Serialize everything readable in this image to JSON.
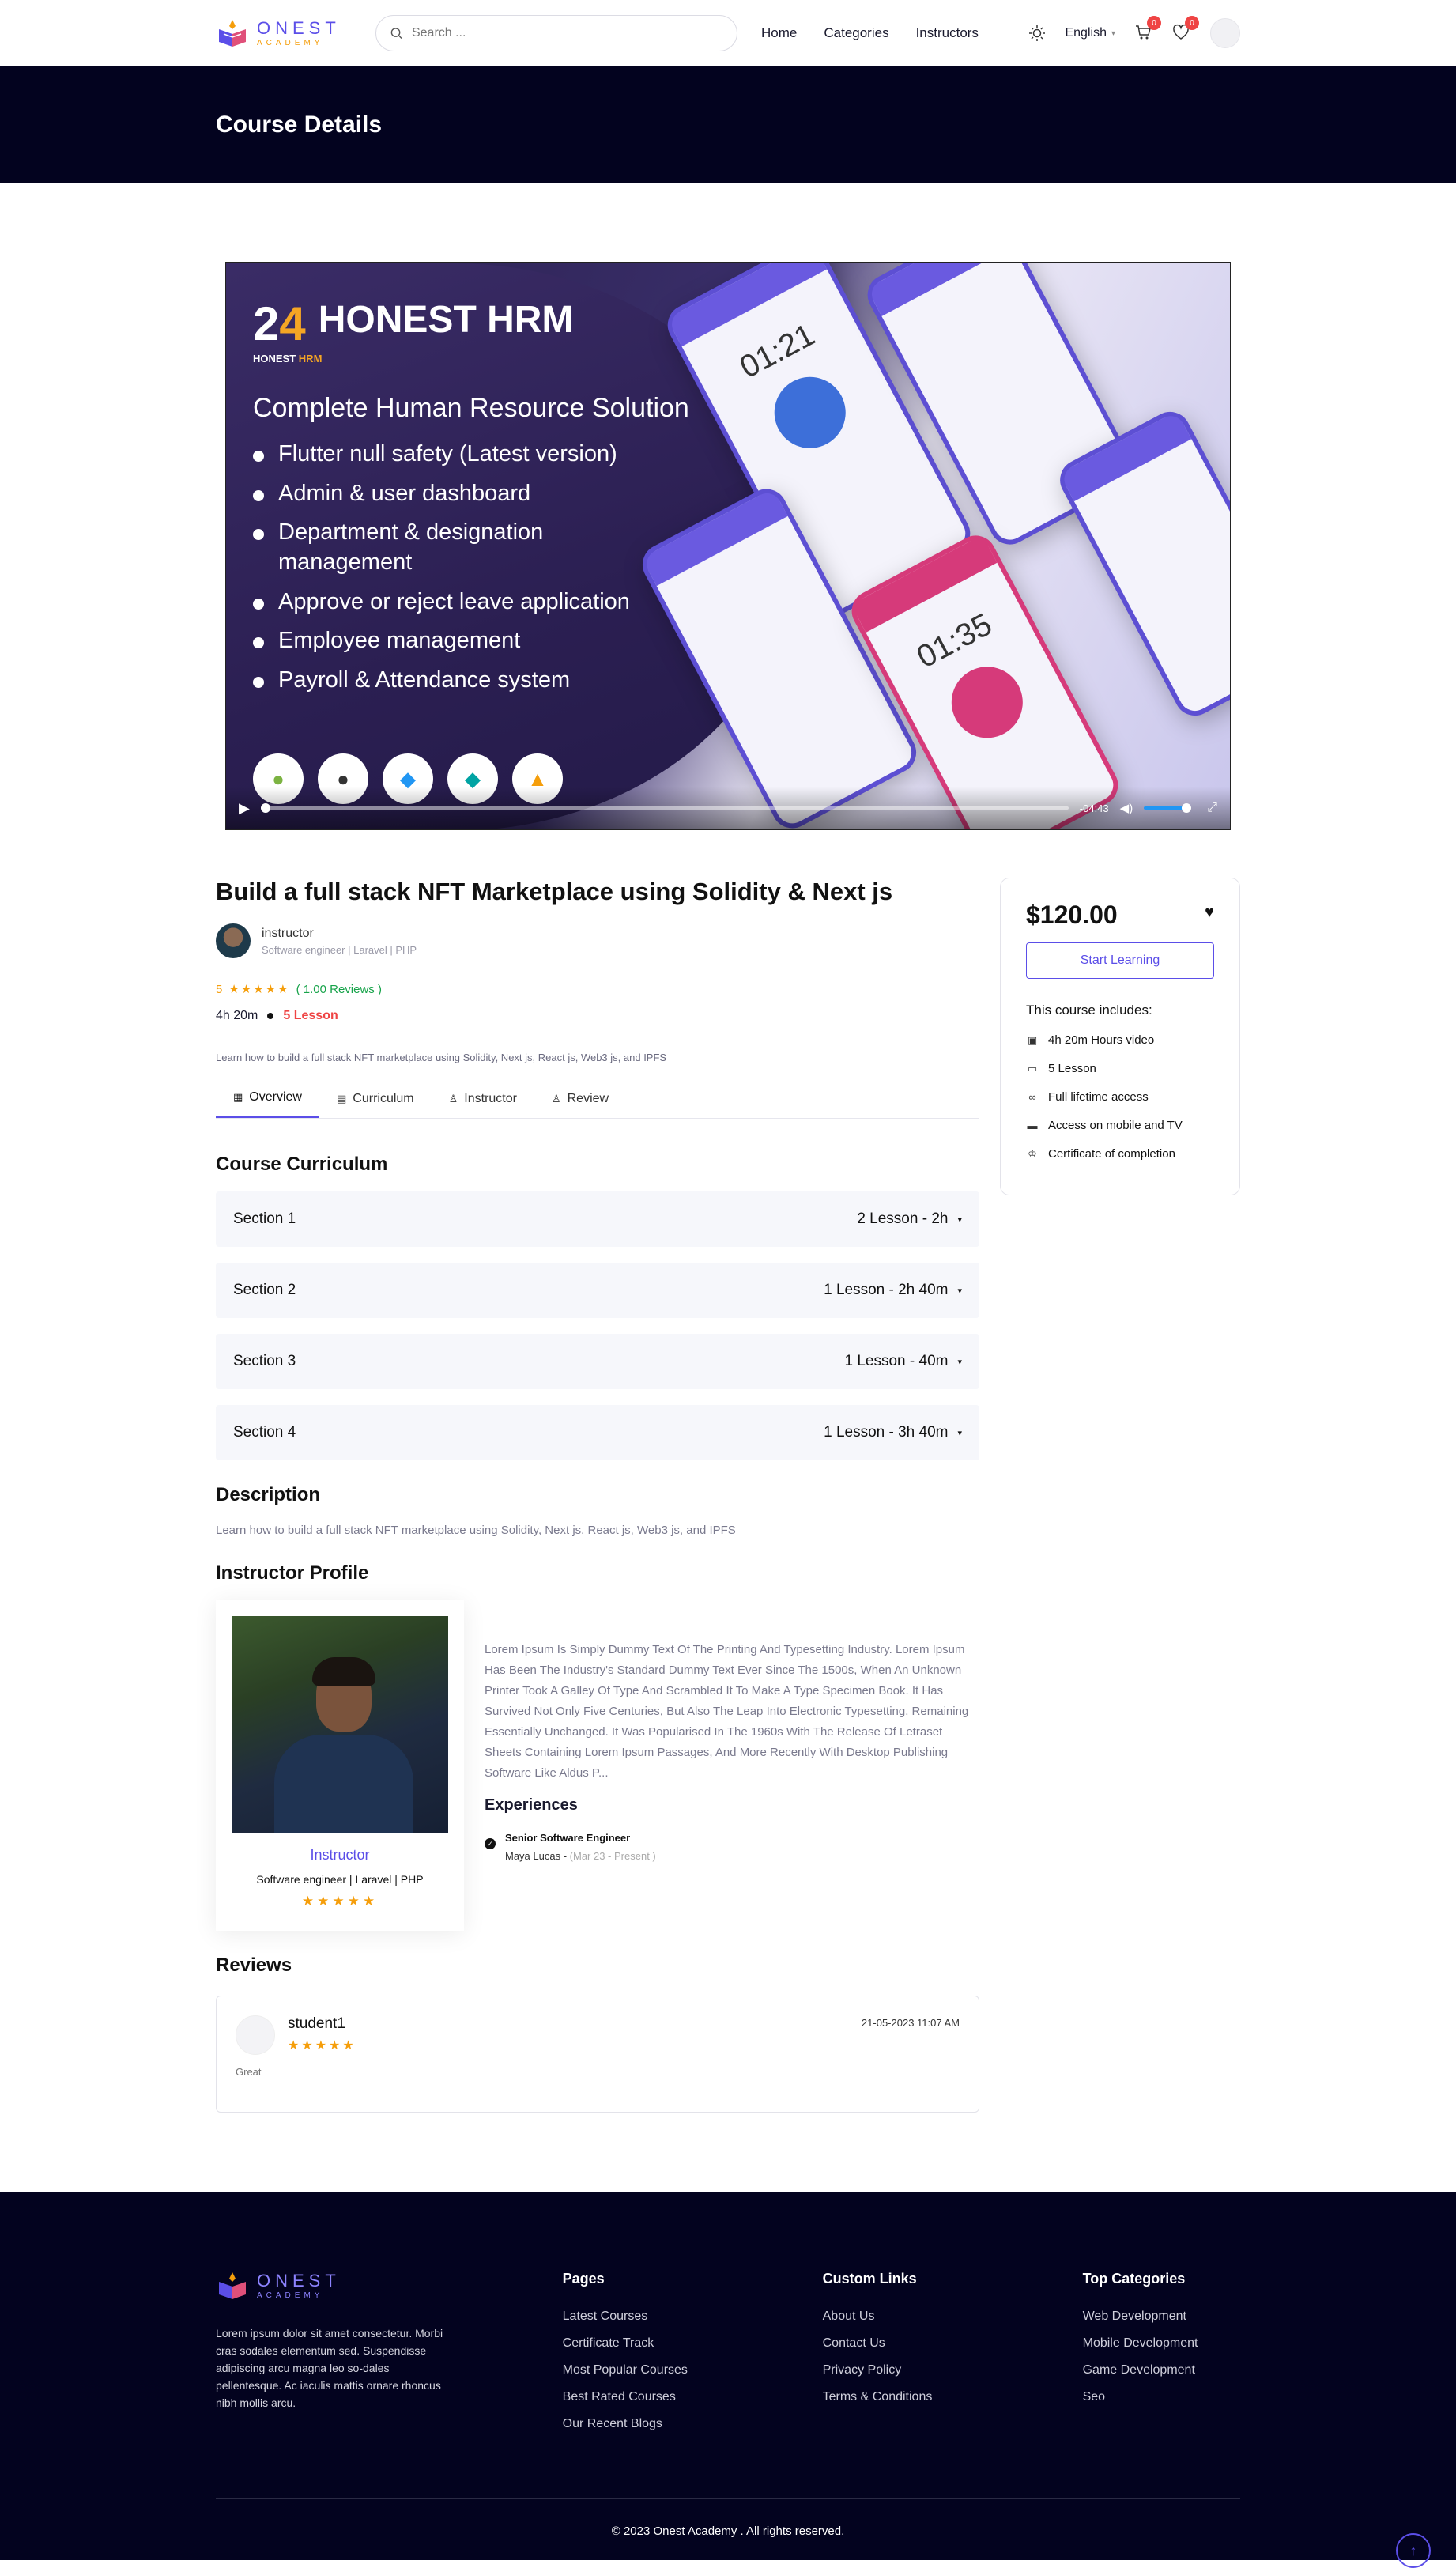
{
  "header": {
    "logo_main": "ONEST",
    "logo_sub": "ACADEMY",
    "search_placeholder": "Search ...",
    "nav": [
      "Home",
      "Categories",
      "Instructors"
    ],
    "language": "English",
    "cart_count": "0",
    "wishlist_count": "0"
  },
  "banner": {
    "title": "Course Details"
  },
  "video": {
    "logo_num_a": "2",
    "logo_num_b": "4",
    "brand": "HONEST HRM",
    "sub_a": "HONEST ",
    "sub_b": "HRM",
    "headline": "Complete Human Resource Solution",
    "features": [
      "Flutter null safety (Latest version)",
      "Admin & user dashboard",
      "Department & designation management",
      "Approve or reject leave application",
      "Employee management",
      "Payroll & Attendance system"
    ],
    "phone_times": [
      "01:21",
      "01:35"
    ],
    "time_remaining": "-04:43"
  },
  "course": {
    "title": "Build a full stack NFT Marketplace using Solidity & Next js",
    "instructor_name": "instructor",
    "instructor_role": "Software engineer | Laravel | PHP",
    "rating": "5",
    "stars": "★★★★★",
    "reviews": "( 1.00 Reviews )",
    "duration": "4h 20m",
    "lessons": "5 Lesson",
    "short_description": "Learn how to build a full stack NFT marketplace using Solidity, Next js, React js, Web3 js, and IPFS"
  },
  "tabs": [
    "Overview",
    "Curriculum",
    "Instructor",
    "Review"
  ],
  "curriculum": {
    "title": "Course Curriculum",
    "sections": [
      {
        "name": "Section 1",
        "info": "2 Lesson - 2h"
      },
      {
        "name": "Section 2",
        "info": "1 Lesson - 2h 40m"
      },
      {
        "name": "Section 3",
        "info": "1 Lesson - 40m"
      },
      {
        "name": "Section 4",
        "info": "1 Lesson - 3h 40m"
      }
    ]
  },
  "description": {
    "title": "Description",
    "text": "Learn how to build a full stack NFT marketplace using Solidity, Next js, React js, Web3 js, and IPFS"
  },
  "profile": {
    "title": "Instructor Profile",
    "name": "Instructor",
    "role": "Software engineer | Laravel | PHP",
    "stars": "★★★★★",
    "bio": "Lorem Ipsum Is Simply Dummy Text Of The Printing And Typesetting Industry. Lorem Ipsum Has Been The Industry's Standard Dummy Text Ever Since The 1500s, When An Unknown Printer Took A Galley Of Type And Scrambled It To Make A Type Specimen Book. It Has Survived Not Only Five Centuries, But Also The Leap Into Electronic Typesetting, Remaining Essentially Unchanged. It Was Popularised In The 1960s With The Release Of Letraset Sheets Containing Lorem Ipsum Passages, And More Recently With Desktop Publishing Software Like Aldus P...",
    "experiences_title": "Experiences",
    "exp_role": "Senior Software Engineer",
    "exp_org": "Maya Lucas - ",
    "exp_period": " (Mar 23 - Present )"
  },
  "reviews": {
    "title": "Reviews",
    "items": [
      {
        "name": "student1",
        "stars": "★★★★★",
        "date": "21-05-2023 11:07 AM",
        "text": "Great"
      }
    ]
  },
  "price_card": {
    "price": "$120.00",
    "button": "Start Learning",
    "includes_title": "This course includes:",
    "includes": [
      {
        "icon": "video-icon",
        "text": "4h 20m Hours video"
      },
      {
        "icon": "lesson-icon",
        "text": "5 Lesson"
      },
      {
        "icon": "link-icon",
        "text": "Full lifetime access"
      },
      {
        "icon": "laptop-icon",
        "text": "Access on mobile and TV"
      },
      {
        "icon": "trophy-icon",
        "text": "Certificate of completion"
      }
    ]
  },
  "footer": {
    "about": "Lorem ipsum dolor sit amet consectetur. Morbi cras sodales elementum sed. Suspendisse adipiscing arcu magna leo so-dales pellentesque. Ac iaculis mattis ornare rhoncus nibh mollis arcu.",
    "pages_title": "Pages",
    "pages": [
      "Latest Courses",
      "Certificate Track",
      "Most Popular Courses",
      "Best Rated Courses",
      "Our Recent Blogs"
    ],
    "custom_title": "Custom Links",
    "custom": [
      "About Us",
      "Contact Us",
      "Privacy Policy",
      "Terms & Conditions"
    ],
    "categories_title": "Top Categories",
    "categories": [
      "Web Development",
      "Mobile Development",
      "Game Development",
      "Seo"
    ],
    "copyright": "© 2023 Onest Academy . All rights reserved."
  },
  "colors": {
    "accent": "#5b4ee8",
    "dark": "#03031f",
    "star": "#f59e0b",
    "danger": "#ef4444"
  }
}
